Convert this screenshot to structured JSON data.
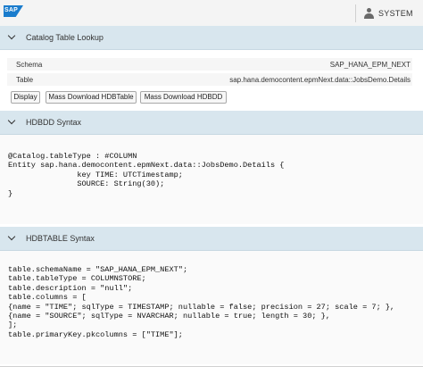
{
  "shell": {
    "logo_text": "SAP",
    "user_label": "SYSTEM"
  },
  "lookup": {
    "title": "Catalog Table Lookup",
    "schema_label": "Schema",
    "schema_value": "SAP_HANA_EPM_NEXT",
    "table_label": "Table",
    "table_value": "sap.hana.democontent.epmNext.data::JobsDemo.Details",
    "buttons": {
      "display": "Display",
      "download_hdbtable": "Mass Download HDBTable",
      "download_hdbdd": "Mass Download HDBDD"
    }
  },
  "hdbdd": {
    "title": "HDBDD Syntax",
    "lines": [
      "@Catalog.tableType : #COLUMN",
      "Entity sap.hana.democontent.epmNext.data::JobsDemo.Details {",
      "               key TIME: UTCTimestamp;",
      "               SOURCE: String(30);",
      "}"
    ]
  },
  "hdbtable": {
    "title": "HDBTABLE Syntax",
    "lines": [
      "table.schemaName = \"SAP_HANA_EPM_NEXT\";",
      "table.tableType = COLUMNSTORE;",
      "table.description = \"null\";",
      "table.columns = [",
      "{name = \"TIME\"; sqlType = TIMESTAMP; nullable = false; precision = 27; scale = 7; },",
      "{name = \"SOURCE\"; sqlType = NVARCHAR; nullable = true; length = 30; },",
      "];",
      "table.primaryKey.pkcolumns = [\"TIME\"];"
    ]
  },
  "colors": {
    "panel_header": "#d8e6ee",
    "brand": "#1a7ccd"
  }
}
